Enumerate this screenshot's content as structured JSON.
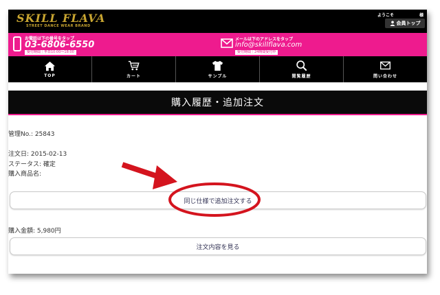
{
  "header": {
    "logo_text": "SKILL FLAVA",
    "logo_tagline": "STREET DANCE WEAR BRAND",
    "welcome": "ようこそ",
    "welcome_suffix": "様",
    "member_top_label": "会員トップ"
  },
  "contact": {
    "tel_note": "お電話は下の番号をタップ",
    "tel_number": "03-6806-6550",
    "tel_hours": "受付時間｜平日10:00〜18:00",
    "mail_note": "メールは下のアドレスをタップ",
    "mail_address": "info@skillflava.com",
    "mail_hours": "受付時間｜24時間受付中",
    "accent_color": "#ee1b8e"
  },
  "nav": {
    "items": [
      {
        "label": "TOP",
        "icon": "home-icon"
      },
      {
        "label": "カート",
        "icon": "cart-icon"
      },
      {
        "label": "サンプル",
        "icon": "tshirt-icon"
      },
      {
        "label": "閲覧履歴",
        "icon": "search-icon"
      },
      {
        "label": "問い合わせ",
        "icon": "mail-icon"
      }
    ]
  },
  "page": {
    "title": "購入履歴・追加注文"
  },
  "order": {
    "management_no": "管理No.: 25843",
    "order_date": "注文日: 2015-02-13",
    "status": "ステータス: 確定",
    "product_name": "購入商品名:",
    "reorder_label": "同じ仕様で追加注文する",
    "amount": "購入金額: 5,980円",
    "view_details_label": "注文内容を見る"
  }
}
